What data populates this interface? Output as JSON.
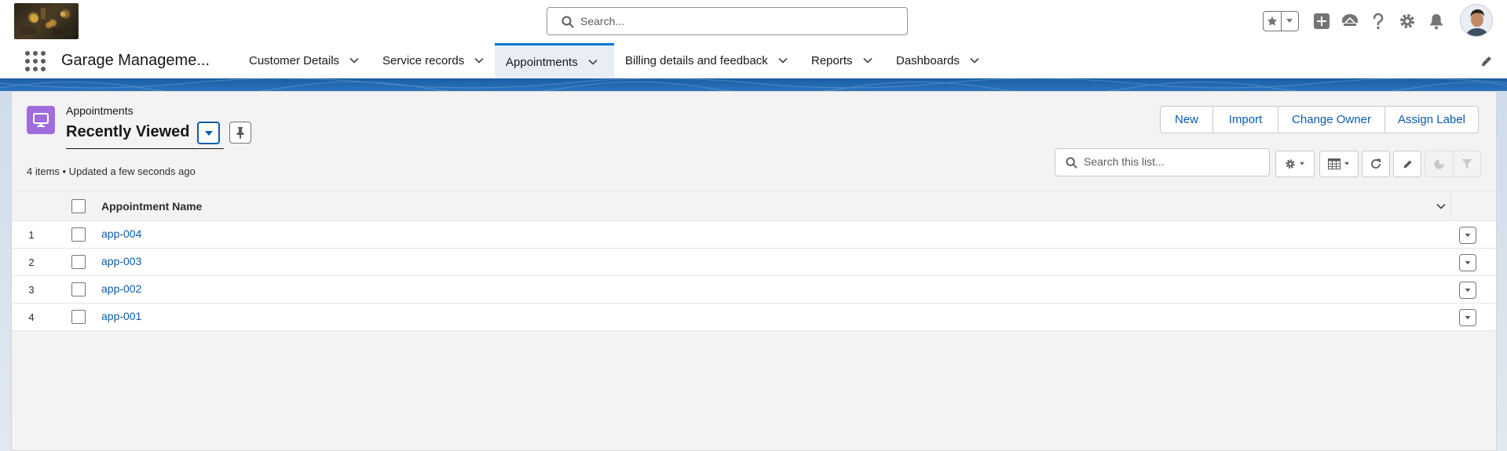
{
  "header": {
    "search_placeholder": "Search..."
  },
  "nav": {
    "app_name": "Garage Manageme...",
    "tabs": [
      {
        "label": "Customer Details"
      },
      {
        "label": "Service records"
      },
      {
        "label": "Appointments",
        "active": true
      },
      {
        "label": "Billing details and feedback"
      },
      {
        "label": "Reports"
      },
      {
        "label": "Dashboards"
      }
    ]
  },
  "list_view": {
    "object_label": "Appointments",
    "title": "Recently Viewed",
    "meta": "4 items • Updated a few seconds ago",
    "actions": [
      "New",
      "Import",
      "Change Owner",
      "Assign Label"
    ],
    "search_placeholder": "Search this list...",
    "columns": [
      "Appointment Name"
    ],
    "rows": [
      {
        "num": "1",
        "name": "app-004"
      },
      {
        "num": "2",
        "name": "app-003"
      },
      {
        "num": "3",
        "name": "app-002"
      },
      {
        "num": "4",
        "name": "app-001"
      }
    ]
  },
  "colors": {
    "brand_blue": "#0176d3",
    "link_blue": "#0b5cab",
    "object_icon_purple": "#9f6cdc",
    "banner_blue": "#1b5fa5"
  },
  "icons": [
    "app-launcher-icon",
    "search-icon",
    "favorites-star-icon",
    "add-icon",
    "trailhead-icon",
    "help-icon",
    "setup-gear-icon",
    "notifications-bell-icon",
    "edit-pencil-icon",
    "pin-icon",
    "refresh-icon",
    "chart-icon",
    "filter-icon",
    "table-icon"
  ]
}
